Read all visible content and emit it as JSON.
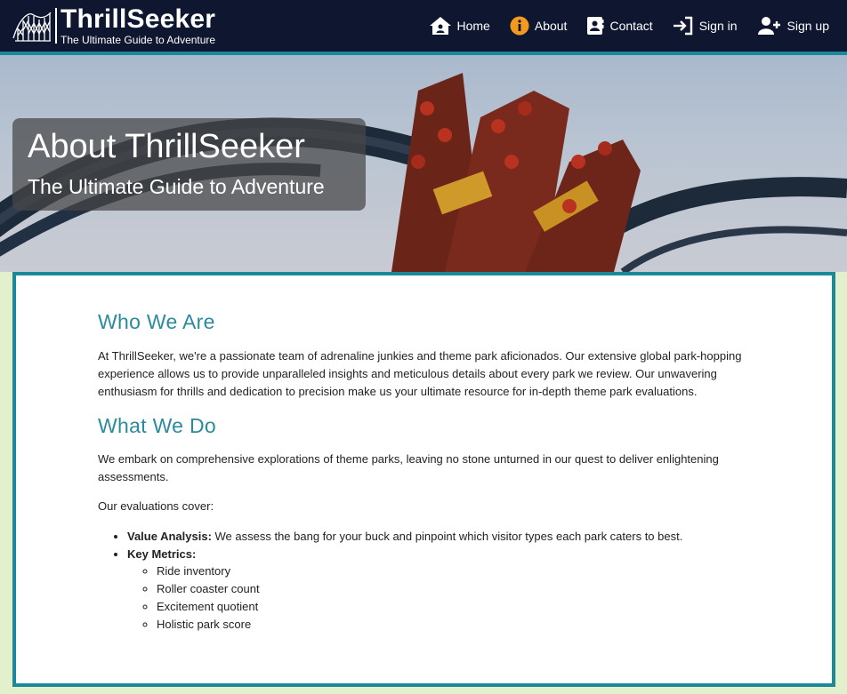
{
  "brand": {
    "name": "ThrillSeeker",
    "tagline": "The Ultimate Guide to Adventure"
  },
  "nav": {
    "items": [
      {
        "label": "Home",
        "icon": "home-icon"
      },
      {
        "label": "About",
        "icon": "info-icon"
      },
      {
        "label": "Contact",
        "icon": "contact-card-icon"
      },
      {
        "label": "Sign in",
        "icon": "sign-in-icon"
      },
      {
        "label": "Sign up",
        "icon": "add-user-icon"
      }
    ]
  },
  "hero": {
    "title": "About ThrillSeeker",
    "subtitle": "The Ultimate Guide to Adventure"
  },
  "main": {
    "who_heading": "Who We Are",
    "who_text": "At ThrillSeeker, we're a passionate team of adrenaline junkies and theme park aficionados. Our extensive global park-hopping experience allows us to provide unparalleled insights and meticulous details about every park we review. Our unwavering enthusiasm for thrills and dedication to precision make us your ultimate resource for in-depth theme park evaluations.",
    "what_heading": "What We Do",
    "what_text": "We embark on comprehensive explorations of theme parks, leaving no stone unturned in our quest to deliver enlightening assessments.",
    "cover_intro": "Our evaluations cover:",
    "value_label": "Value Analysis:",
    "value_text": " We assess the bang for your buck and pinpoint which visitor types each park caters to best.",
    "metrics_label": "Key Metrics:",
    "metrics": [
      "Ride inventory",
      "Roller coaster count",
      "Excitement quotient",
      "Holistic park score"
    ]
  },
  "colors": {
    "header_bg": "#0f1730",
    "accent_teal": "#1a8a9a",
    "heading_teal": "#2b8b9c",
    "page_bg": "#e2f0cb",
    "about_icon_orange": "#f29a1f"
  }
}
